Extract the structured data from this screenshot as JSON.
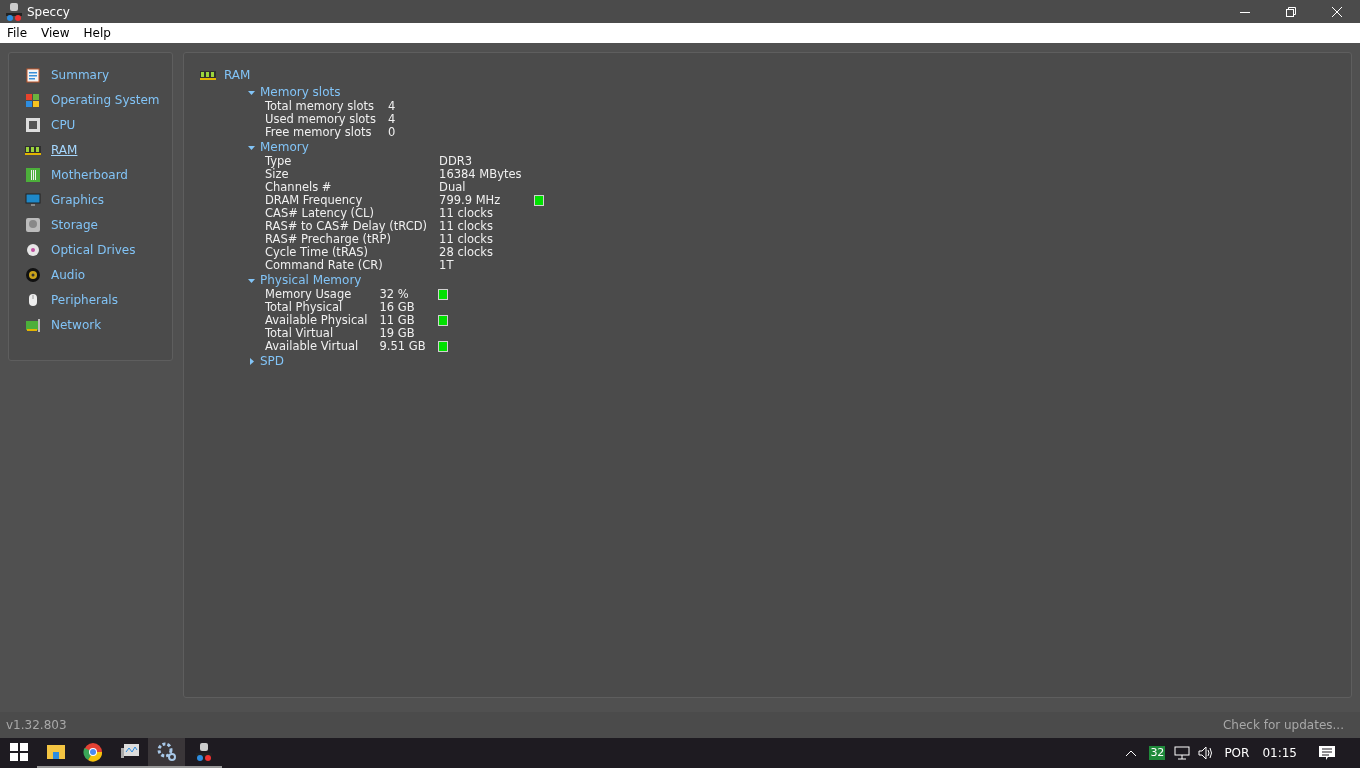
{
  "window": {
    "title": "Speccy"
  },
  "menu": [
    "File",
    "View",
    "Help"
  ],
  "sidebar": {
    "items": [
      {
        "label": "Summary",
        "selected": false
      },
      {
        "label": "Operating System",
        "selected": false
      },
      {
        "label": "CPU",
        "selected": false
      },
      {
        "label": "RAM",
        "selected": true
      },
      {
        "label": "Motherboard",
        "selected": false
      },
      {
        "label": "Graphics",
        "selected": false
      },
      {
        "label": "Storage",
        "selected": false
      },
      {
        "label": "Optical Drives",
        "selected": false
      },
      {
        "label": "Audio",
        "selected": false
      },
      {
        "label": "Peripherals",
        "selected": false
      },
      {
        "label": "Network",
        "selected": false
      }
    ]
  },
  "content": {
    "title": "RAM",
    "sections": [
      {
        "title": "Memory slots",
        "expanded": true,
        "rows": [
          {
            "label": "Total memory slots",
            "value": "4",
            "indicator": false
          },
          {
            "label": "Used memory slots",
            "value": "4",
            "indicator": false
          },
          {
            "label": "Free memory slots",
            "value": "0",
            "indicator": false
          }
        ]
      },
      {
        "title": "Memory",
        "expanded": true,
        "rows": [
          {
            "label": "Type",
            "value": "DDR3",
            "indicator": false
          },
          {
            "label": "Size",
            "value": "16384 MBytes",
            "indicator": false
          },
          {
            "label": "Channels #",
            "value": "Dual",
            "indicator": false
          },
          {
            "label": "DRAM Frequency",
            "value": "799.9 MHz",
            "indicator": true
          },
          {
            "label": "CAS# Latency (CL)",
            "value": "11 clocks",
            "indicator": false
          },
          {
            "label": "RAS# to CAS# Delay (tRCD)",
            "value": "11 clocks",
            "indicator": false
          },
          {
            "label": "RAS# Precharge (tRP)",
            "value": "11 clocks",
            "indicator": false
          },
          {
            "label": "Cycle Time (tRAS)",
            "value": "28 clocks",
            "indicator": false
          },
          {
            "label": "Command Rate (CR)",
            "value": "1T",
            "indicator": false
          }
        ]
      },
      {
        "title": "Physical Memory",
        "expanded": true,
        "rows": [
          {
            "label": "Memory Usage",
            "value": "32 %",
            "indicator": true
          },
          {
            "label": "Total Physical",
            "value": "16 GB",
            "indicator": false
          },
          {
            "label": "Available Physical",
            "value": "11 GB",
            "indicator": true
          },
          {
            "label": "Total Virtual",
            "value": "19 GB",
            "indicator": false
          },
          {
            "label": "Available Virtual",
            "value": "9.51 GB",
            "indicator": true
          }
        ]
      },
      {
        "title": "SPD",
        "expanded": false
      }
    ]
  },
  "status_bar": {
    "version": "v1.32.803",
    "update_link": "Check for updates..."
  },
  "taskbar": {
    "apps": [
      {
        "running": false,
        "active": false
      },
      {
        "running": true,
        "active": false
      },
      {
        "running": true,
        "active": false
      },
      {
        "running": true,
        "active": false
      },
      {
        "running": true,
        "active": true
      },
      {
        "running": true,
        "active": false
      }
    ],
    "tray": {
      "badge": "32",
      "language": "POR",
      "time": "01:15"
    }
  }
}
